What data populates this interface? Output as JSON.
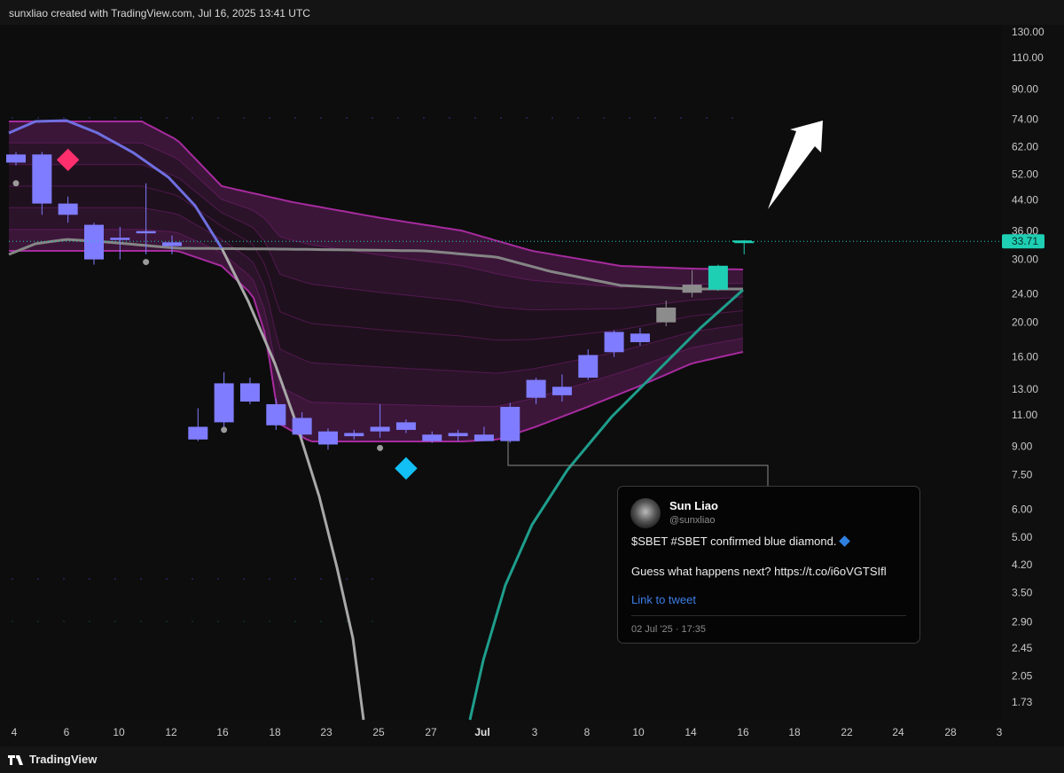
{
  "header": {
    "text": "sunxliao created with TradingView.com, Jul 16, 2025 13:41 UTC"
  },
  "footer": {
    "brand": "TradingView"
  },
  "colors": {
    "background": "#0d0d0d",
    "candle_up": "#7f7cff",
    "candle_neutral": "#8c8c8c",
    "candle_last": "#1ecfb4",
    "band": "#a72b9e",
    "ma_gray": "#858585",
    "curve_blue": "#6f6fe0",
    "curve_gray": "#a8a8a8",
    "curve_teal": "#1e9e8c",
    "diamond_red": "#ff2f6e",
    "diamond_blue": "#12c0f5",
    "price_label": "#1ecfb4"
  },
  "chart_data": {
    "type": "candlestick",
    "scale": "log",
    "ylim": [
      1.6,
      138
    ],
    "y_ticks": [
      130,
      110,
      90,
      74,
      62,
      52,
      44,
      36,
      30,
      24,
      20,
      16,
      13,
      11,
      9,
      7.5,
      6,
      5,
      4.2,
      3.5,
      2.9,
      2.45,
      2.05,
      1.73
    ],
    "y_tick_labels": [
      "130.00",
      "110.00",
      "90.00",
      "74.00",
      "62.00",
      "52.00",
      "44.00",
      "36.00",
      "30.00",
      "24.00",
      "20.00",
      "16.00",
      "13.00",
      "11.00",
      "9.00",
      "7.50",
      "6.00",
      "5.00",
      "4.20",
      "3.50",
      "2.90",
      "2.45",
      "2.05",
      "1.73"
    ],
    "x_tick_labels": [
      "4",
      "6",
      "10",
      "12",
      "16",
      "18",
      "23",
      "25",
      "27",
      "Jul",
      "3",
      "8",
      "10",
      "14",
      "16",
      "18",
      "22",
      "24",
      "28",
      "3"
    ],
    "last_price": 33.71,
    "last_price_label": "33.71",
    "candles": [
      {
        "o": 56,
        "h": 60,
        "l": 55,
        "c": 59,
        "color": "up"
      },
      {
        "o": 59,
        "h": 60,
        "l": 40,
        "c": 43,
        "color": "up"
      },
      {
        "o": 43,
        "h": 45,
        "l": 38,
        "c": 40,
        "color": "up"
      },
      {
        "o": 37.5,
        "h": 38,
        "l": 29,
        "c": 30,
        "color": "up"
      },
      {
        "o": 34,
        "h": 37,
        "l": 30,
        "c": 34.5,
        "color": "up"
      },
      {
        "o": 35.5,
        "h": 49,
        "l": 31,
        "c": 36,
        "color": "up"
      },
      {
        "o": 33.5,
        "h": 35,
        "l": 31,
        "c": 32.7,
        "color": "up"
      },
      {
        "o": 10.2,
        "h": 11.5,
        "l": 9.3,
        "c": 9.4,
        "color": "up"
      },
      {
        "o": 13.5,
        "h": 14.5,
        "l": 10.2,
        "c": 10.5,
        "color": "up"
      },
      {
        "o": 13.5,
        "h": 14,
        "l": 11.8,
        "c": 12,
        "color": "up"
      },
      {
        "o": 11.8,
        "h": 12.2,
        "l": 10,
        "c": 10.3,
        "color": "up"
      },
      {
        "o": 10.8,
        "h": 11.2,
        "l": 9.5,
        "c": 9.7,
        "color": "up"
      },
      {
        "o": 9.9,
        "h": 10.1,
        "l": 8.8,
        "c": 9.1,
        "color": "up"
      },
      {
        "o": 9.8,
        "h": 10,
        "l": 9.4,
        "c": 9.6,
        "color": "up"
      },
      {
        "o": 10.2,
        "h": 11.8,
        "l": 9.5,
        "c": 9.9,
        "color": "up"
      },
      {
        "o": 10.5,
        "h": 10.7,
        "l": 9.8,
        "c": 10,
        "color": "up"
      },
      {
        "o": 9.7,
        "h": 9.9,
        "l": 9.2,
        "c": 9.3,
        "color": "up"
      },
      {
        "o": 9.8,
        "h": 10,
        "l": 9.3,
        "c": 9.6,
        "color": "up"
      },
      {
        "o": 9.7,
        "h": 10.2,
        "l": 9.3,
        "c": 9.3,
        "color": "up"
      },
      {
        "o": 11.6,
        "h": 11.9,
        "l": 9.2,
        "c": 9.3,
        "color": "up"
      },
      {
        "o": 13.8,
        "h": 14,
        "l": 11.8,
        "c": 12.3,
        "color": "up"
      },
      {
        "o": 13.2,
        "h": 14.3,
        "l": 12,
        "c": 12.5,
        "color": "up"
      },
      {
        "o": 16.2,
        "h": 16.8,
        "l": 13.8,
        "c": 14,
        "color": "up"
      },
      {
        "o": 18.8,
        "h": 19,
        "l": 16,
        "c": 16.5,
        "color": "up"
      },
      {
        "o": 18.6,
        "h": 19.3,
        "l": 17.2,
        "c": 17.6,
        "color": "up"
      },
      {
        "o": 22,
        "h": 23,
        "l": 19.5,
        "c": 20,
        "color": "neutral"
      },
      {
        "o": 25.5,
        "h": 28,
        "l": 23.5,
        "c": 24.2,
        "color": "neutral"
      },
      {
        "o": 28.8,
        "h": 29,
        "l": 24.5,
        "c": 24.7,
        "color": "last"
      },
      {
        "o": 33.71,
        "h": 34,
        "l": 31,
        "c": 33.71,
        "color": "last"
      }
    ],
    "markers": [
      {
        "type": "diamond",
        "color": "red",
        "candle": 2,
        "y": 57
      },
      {
        "type": "diamond",
        "color": "blue",
        "candle": 15,
        "y": 7.8
      },
      {
        "type": "dot",
        "candle": 0,
        "y": 49
      },
      {
        "type": "dot",
        "candle": 5,
        "y": 29.5
      },
      {
        "type": "dot",
        "candle": 8,
        "y": 10
      },
      {
        "type": "dot",
        "candle": 14,
        "y": 8.9
      }
    ]
  },
  "tweet": {
    "name": "Sun Liao",
    "handle": "@sunxliao",
    "text1": "$SBET #SBET confirmed blue diamond.",
    "text2": "Guess what happens next? https://t.co/i6oVGTSIfl",
    "link": "Link to tweet",
    "date": "02 Jul '25 · 17:35"
  }
}
